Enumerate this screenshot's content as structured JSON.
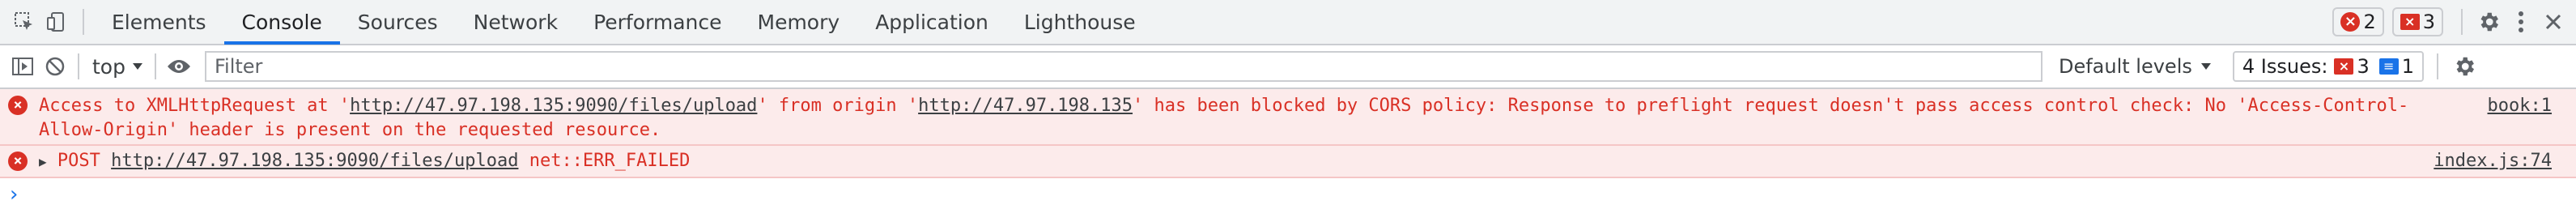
{
  "tabs": [
    "Elements",
    "Console",
    "Sources",
    "Network",
    "Performance",
    "Memory",
    "Application",
    "Lighthouse"
  ],
  "active_tab": "Console",
  "counts": {
    "errors": "2",
    "warnings": "3"
  },
  "toolbar": {
    "context": "top",
    "filter_placeholder": "Filter",
    "levels": "Default levels",
    "issues_label": "4 Issues:",
    "issues_errors": "3",
    "issues_info": "1"
  },
  "messages": [
    {
      "text_before": "Access to XMLHttpRequest at '",
      "url1": "http://47.97.198.135:9090/files/upload",
      "text_mid": "' from origin '",
      "url2": "http://47.97.198.135",
      "text_after": "' has been blocked by CORS policy: Response to preflight request doesn't pass access control check: No 'Access-Control-Allow-Origin' header is present on the requested resource.",
      "source": "book:1"
    },
    {
      "method": "POST",
      "url": "http://47.97.198.135:9090/files/upload",
      "error": "net::ERR_FAILED",
      "source": "index.js:74"
    }
  ],
  "colors": {
    "error": "#d93025",
    "accent": "#1a73e8",
    "error_bg": "#fcebeb"
  }
}
